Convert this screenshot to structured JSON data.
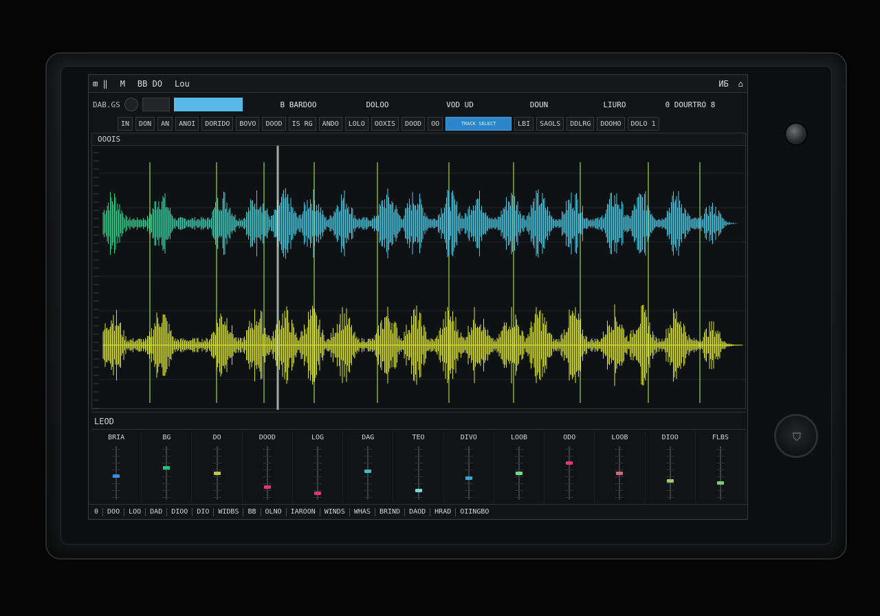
{
  "menubar": {
    "left": [
      "⊞ ‖",
      "M",
      "BB DO",
      "Lou"
    ],
    "right": [
      "ИБ",
      "⌂"
    ]
  },
  "toolbar1": {
    "label": "DAB.GS",
    "fields": [
      "B BARDOO",
      "DOLOO",
      "VOD UD",
      "DOUN",
      "LIURO",
      "0 DOURTRO 8"
    ]
  },
  "toolbar2": {
    "buttons": [
      "IN",
      "DON",
      "AN",
      "ANOI",
      "DORIDO",
      "BOVO",
      "DOOD",
      "IS RG",
      "ANDO",
      "LOLO",
      "OOXIS",
      "DOOD",
      "OO",
      "TRACK SELECT",
      "LBI",
      "SAOLS",
      "DDLRG",
      "DOOHO",
      "DOLO 1"
    ],
    "active_index": 13
  },
  "wave_panel": {
    "title": "OOOIS",
    "colors": {
      "top_track": "#4fd4f0",
      "top_track_start": "#2fe08a",
      "bottom_track": "#e6f030",
      "marker": "#a6d94a",
      "playhead": "#c9d2c8"
    }
  },
  "mixer": {
    "title": "LEOD",
    "channels": [
      {
        "label": "BRIA",
        "accent": "#3b8ee0",
        "level": 0.45
      },
      {
        "label": "BG",
        "accent": "#22c37a",
        "level": 0.62
      },
      {
        "label": "DO",
        "accent": "#c9c44a",
        "level": 0.5
      },
      {
        "label": "DOOD",
        "accent": "#e5356b",
        "level": 0.22
      },
      {
        "label": "LOG",
        "accent": "#e5356b",
        "level": 0.08
      },
      {
        "label": "DAG",
        "accent": "#3fb8d0",
        "level": 0.55
      },
      {
        "label": "TEO",
        "accent": "#6fd9d9",
        "level": 0.15
      },
      {
        "label": "DIVO",
        "accent": "#37a6d9",
        "level": 0.4
      },
      {
        "label": "LOOB",
        "accent": "#6ee08a",
        "level": 0.5
      },
      {
        "label": "ODO",
        "accent": "#e5356b",
        "level": 0.72
      },
      {
        "label": "LOOB",
        "accent": "#d06a7a",
        "level": 0.5
      },
      {
        "label": "DIOO",
        "accent": "#9cc96e",
        "level": 0.35
      },
      {
        "label": "FLBS",
        "accent": "#7ad06e",
        "level": 0.3
      }
    ]
  },
  "statusbar": [
    "0",
    "DOO",
    "LOO",
    "DAD",
    "DIOO",
    "DIO",
    "WIDBS",
    "BB",
    "OLNO",
    "IAROON",
    "WINDS",
    "WHAS",
    "BRIND",
    "DAOD",
    "HRAD",
    "OIINGBO"
  ]
}
